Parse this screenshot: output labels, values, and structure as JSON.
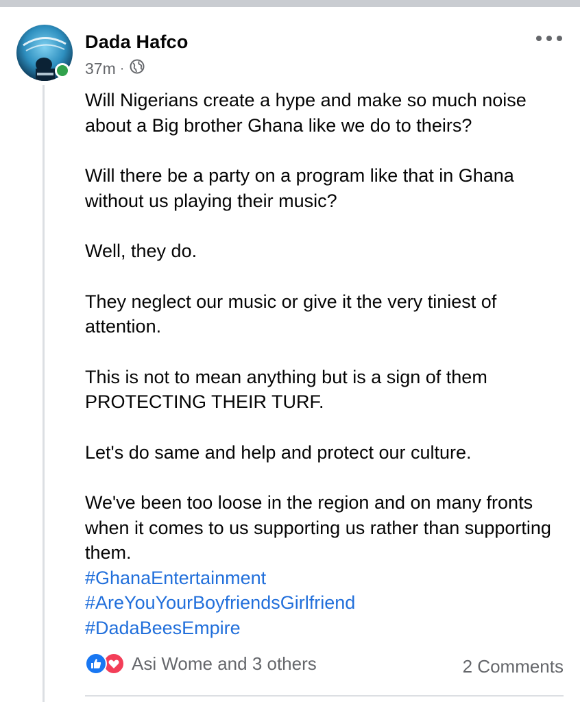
{
  "post": {
    "author": "Dada Hafco",
    "time": "37m",
    "separator": "·",
    "audience_icon": "globe-icon",
    "more_icon": "more-horizontal-icon",
    "paragraphs": [
      "Will Nigerians create a hype and make so much noise about a Big brother Ghana like we do to theirs?",
      "Will there be a party on a program like that in Ghana without us playing their music?",
      "Well, they do.",
      "They neglect our music or give it the very tiniest of attention.",
      "This is not to mean anything but is a sign of them PROTECTING THEIR TURF.",
      "Let's do same and help and protect our culture.",
      "We've been too loose in the region and on many fronts when it comes to us supporting us rather than supporting them."
    ],
    "hashtags": [
      "#GhanaEntertainment",
      "#AreYouYourBoyfriendsGirlfriend",
      "#DadaBeesEmpire"
    ],
    "reactions_text": "Asi Wome and 3 others",
    "comments_text": "2 Comments",
    "reaction_icons": [
      "like-icon",
      "love-icon"
    ]
  },
  "colors": {
    "link": "#216fdb",
    "secondary_text": "#65676b",
    "online": "#31a24c",
    "like": "#1877f2",
    "love": "#f33e58"
  }
}
